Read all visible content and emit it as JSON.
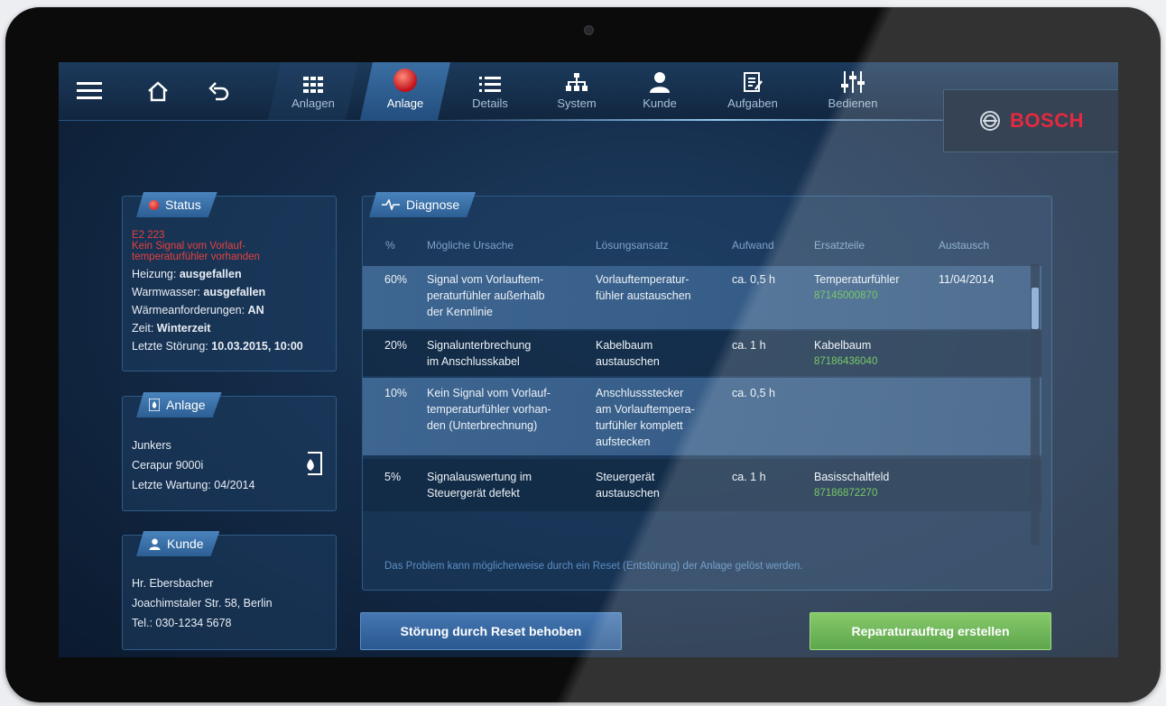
{
  "nav": {
    "tabs": [
      {
        "label": "Anlagen",
        "icon": "grid-list-icon"
      },
      {
        "label": "Anlage",
        "icon": "red-status-dot-icon"
      },
      {
        "label": "Details",
        "icon": "list-icon"
      },
      {
        "label": "System",
        "icon": "hierarchy-icon"
      },
      {
        "label": "Kunde",
        "icon": "user-icon"
      },
      {
        "label": "Aufgaben",
        "icon": "checklist-icon"
      },
      {
        "label": "Bedienen",
        "icon": "sliders-icon"
      }
    ],
    "active_tab": "Anlage",
    "brand": "BOSCH"
  },
  "status": {
    "title": "Status",
    "error_code": "E2 223",
    "error_line1": "Kein Signal vom Vorlauf-",
    "error_line2": "temperaturfühler vorhanden",
    "rows": [
      {
        "label": "Heizung: ",
        "value": "ausgefallen"
      },
      {
        "label": "Warmwasser: ",
        "value": "ausgefallen"
      },
      {
        "label": "Wärmeanforderungen: ",
        "value": "AN"
      },
      {
        "label": "Zeit: ",
        "value": "Winterzeit"
      },
      {
        "label": "Letzte Störung: ",
        "value": "10.03.2015, 10:00"
      }
    ]
  },
  "anlage": {
    "title": "Anlage",
    "lines": [
      "Junkers",
      "Cerapur 9000i",
      "Letzte Wartung: 04/2014"
    ]
  },
  "kunde": {
    "title": "Kunde",
    "lines": [
      "Hr. Ebersbacher",
      "Joachimstaler Str. 58, Berlin",
      "Tel.: 030-1234 5678"
    ]
  },
  "diagnose": {
    "title": "Diagnose",
    "columns": [
      "%",
      "Mögliche Ursache",
      "Lösungsansatz",
      "Aufwand",
      "Ersatzteile",
      "Austausch"
    ],
    "rows": [
      {
        "pct": "60%",
        "cause": [
          "Signal vom Vorlauftem-",
          "peraturfühler außerhalb",
          "der Kennlinie"
        ],
        "solution": [
          "Vorlauftemperatur-",
          "fühler austauschen"
        ],
        "effort": "ca. 0,5 h",
        "part": "Temperaturfühler",
        "part_no": "87145000870",
        "exchange": "11/04/2014"
      },
      {
        "pct": "20%",
        "cause": [
          "Signalunterbrechung",
          "im Anschlusskabel"
        ],
        "solution": [
          "Kabelbaum",
          "austauschen"
        ],
        "effort": "ca. 1 h",
        "part": "Kabelbaum",
        "part_no": "87186436040",
        "exchange": ""
      },
      {
        "pct": "10%",
        "cause": [
          "Kein Signal vom Vorlauf-",
          "temperaturfühler vorhan-",
          "den (Unterbrechnung)"
        ],
        "solution": [
          "Anschlussstecker",
          "am Vorlauftempera-",
          "turfühler komplett",
          "aufstecken"
        ],
        "effort": "ca. 0,5 h",
        "part": "",
        "part_no": "",
        "exchange": ""
      },
      {
        "pct": "5%",
        "cause": [
          "Signalauswertung im",
          "Steuergerät defekt"
        ],
        "solution": [
          "Steuergerät",
          "austauschen"
        ],
        "effort": "ca. 1 h",
        "part": "Basisschaltfeld",
        "part_no": "87186872270",
        "exchange": ""
      }
    ],
    "note": "Das Problem kann möglicherweise durch ein Reset (Entstörung) der Anlage gelöst werden."
  },
  "buttons": {
    "reset": "Störung durch Reset behoben",
    "repair": "Reparaturauftrag erstellen"
  },
  "colors": {
    "accent": "#2c5f94",
    "error": "#e5413c",
    "part_number": "#5fbf4a",
    "brand": "#e2001a",
    "repair_button": "#4fa636"
  }
}
